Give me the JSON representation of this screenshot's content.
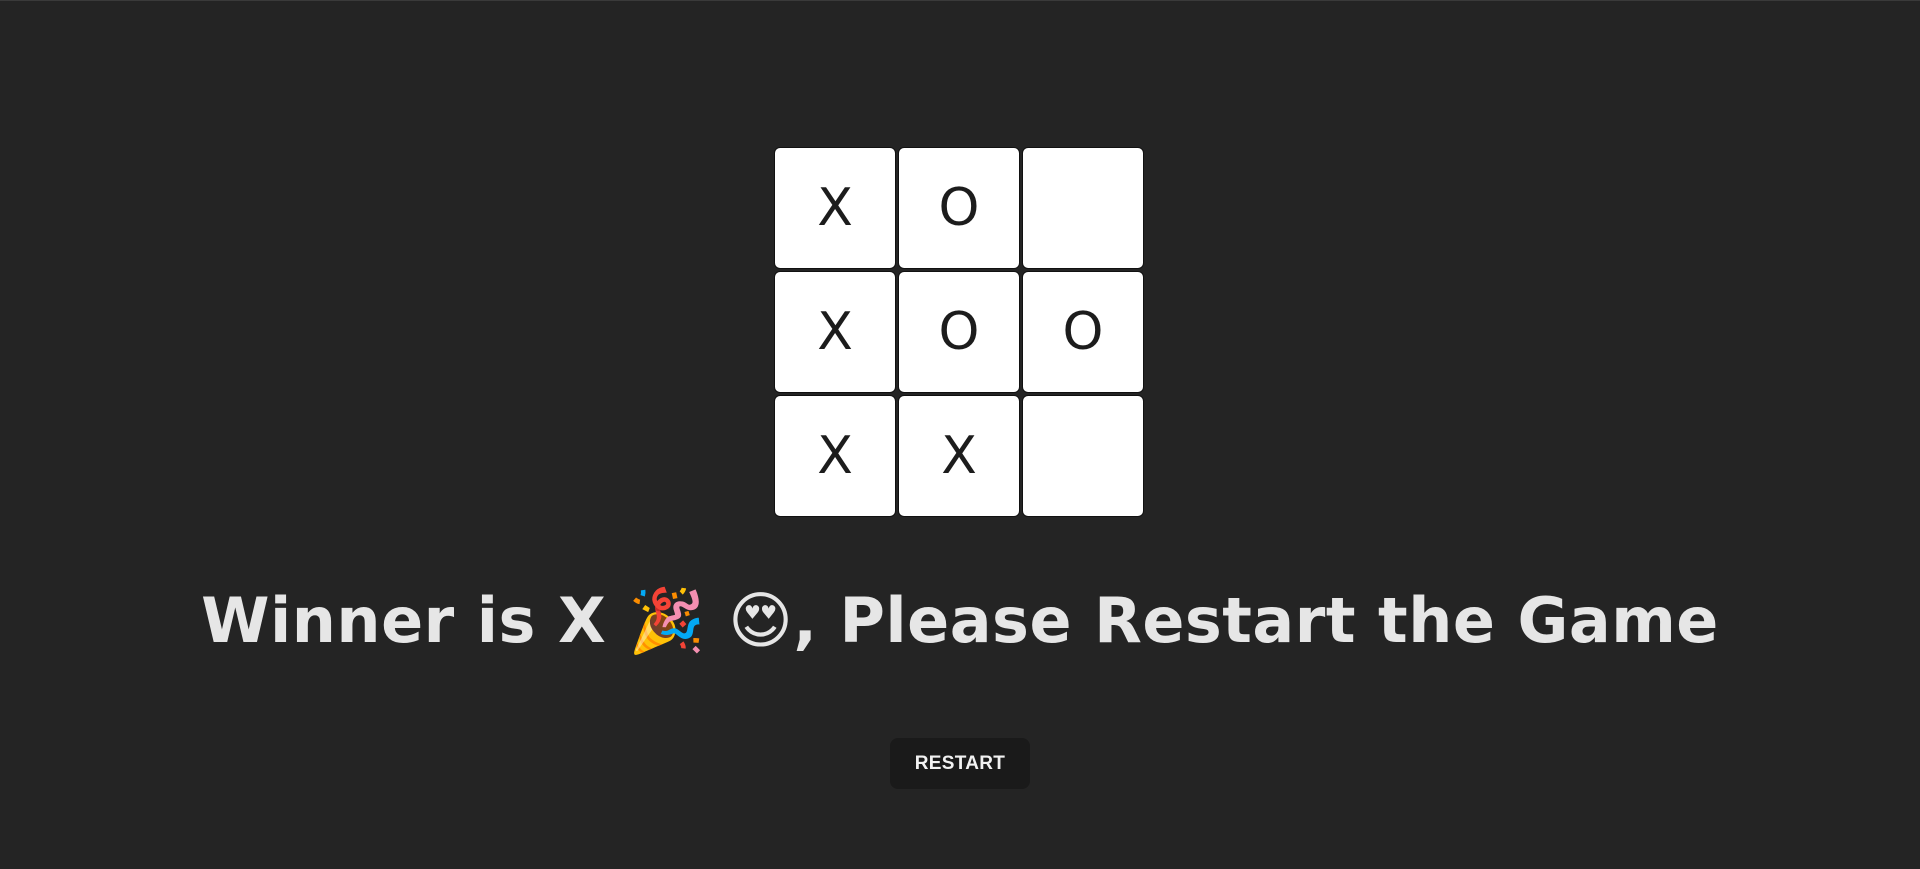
{
  "board": {
    "cells": [
      "X",
      "O",
      "",
      "X",
      "O",
      "O",
      "X",
      "X",
      ""
    ]
  },
  "status": {
    "message": "Winner is X 🎉 😍, Please Restart the Game"
  },
  "controls": {
    "restart_label": "RESTART"
  },
  "colors": {
    "background": "#242424",
    "cell": "#ffffff",
    "text": "#e6e6e6",
    "button": "#1a1a1a"
  }
}
